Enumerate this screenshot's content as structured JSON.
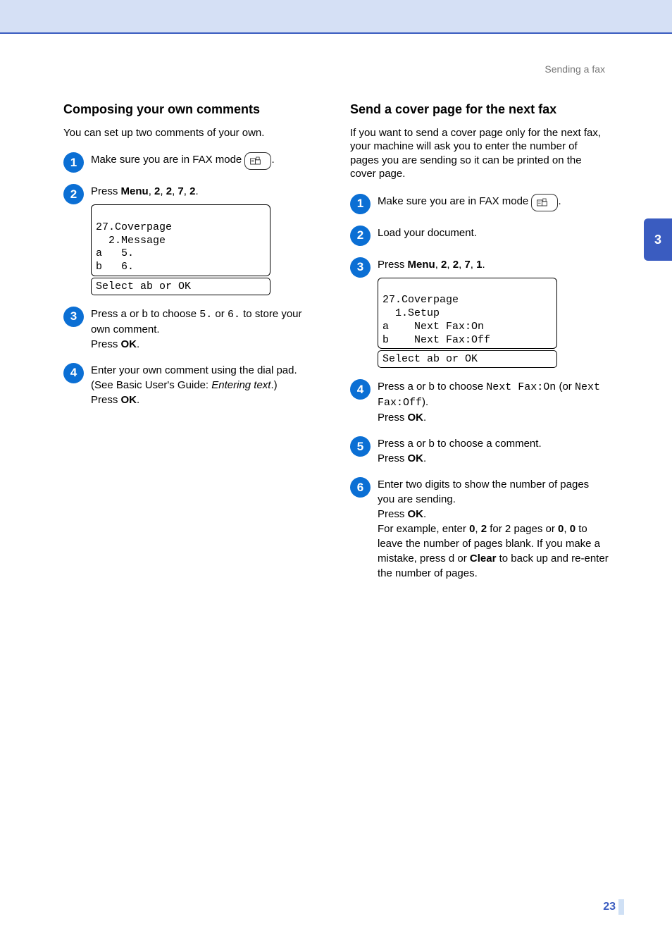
{
  "header": {
    "section": "Sending a fax",
    "chapter": "3"
  },
  "footer": {
    "page": "23"
  },
  "left": {
    "title": "Composing your own comments",
    "intro": "You can set up two comments of your own.",
    "step1": "Make sure you are in FAX mode",
    "step2_a": "Press ",
    "step2_menu": "Menu",
    "step2_b": ", ",
    "step2_n1": "2",
    "step2_n2": "2",
    "step2_n3": "7",
    "step2_n4": "2",
    "step2_end": ".",
    "lcd_line1": "27.Coverpage",
    "lcd_line2": "  2.Message",
    "lcd_line3": "a   5.",
    "lcd_line4": "b   6.",
    "lcd_bottom": "Select ab or OK",
    "step3_a": "Press a or b to choose ",
    "step3_opt1": "5.",
    "step3_mid": " or ",
    "step3_opt2": "6.",
    "step3_b": " to store your own comment.",
    "step3_press": "Press ",
    "step3_ok": "OK",
    "step3_dot": ".",
    "step4_a": "Enter your own comment using the dial pad. (See Basic User's Guide: ",
    "step4_ital": "Entering text",
    "step4_b": ".)",
    "step4_press": "Press ",
    "step4_ok": "OK",
    "step4_dot": "."
  },
  "right": {
    "title": "Send a cover page for the next fax",
    "intro": "If you want to send a cover page only for the next fax, your machine will ask you to enter the number of pages you are sending so it can be printed on the cover page.",
    "step1": "Make sure you are in FAX mode",
    "step2": "Load your document.",
    "step3_a": "Press ",
    "step3_menu": "Menu",
    "step3_b": ", ",
    "step3_n1": "2",
    "step3_n2": "2",
    "step3_n3": "7",
    "step3_n4": "1",
    "step3_end": ".",
    "lcd_line1": "27.Coverpage",
    "lcd_line2": "  1.Setup",
    "lcd_line3": "a    Next Fax:On",
    "lcd_line4": "b    Next Fax:Off",
    "lcd_bottom": "Select ab or OK",
    "step4_a": "Press a or b to choose ",
    "step4_code1": "Next Fax:On",
    "step4_mid": " (or ",
    "step4_code2": "Next Fax:Off",
    "step4_b": ").",
    "step4_press": "Press ",
    "step4_ok": "OK",
    "step4_dot": ".",
    "step5_a": "Press a or b to choose a comment.",
    "step5_press": "Press ",
    "step5_ok": "OK",
    "step5_dot": ".",
    "step6_a": "Enter two digits to show the number of pages you are sending.",
    "step6_press": "Press ",
    "step6_ok": "OK",
    "step6_dot": ".",
    "step6_b1": "For example, enter ",
    "step6_b_0": "0",
    "step6_b_c": ", ",
    "step6_b_2": "2",
    "step6_b2": " for 2 pages or ",
    "step6_c_0": "0",
    "step6_c_c": ", ",
    "step6_c_00": "0",
    "step6_c2": " to leave the number of pages blank. If you make a mistake, press d or ",
    "step6_clear": "Clear",
    "step6_d": " to back up and re-enter the number of pages."
  }
}
